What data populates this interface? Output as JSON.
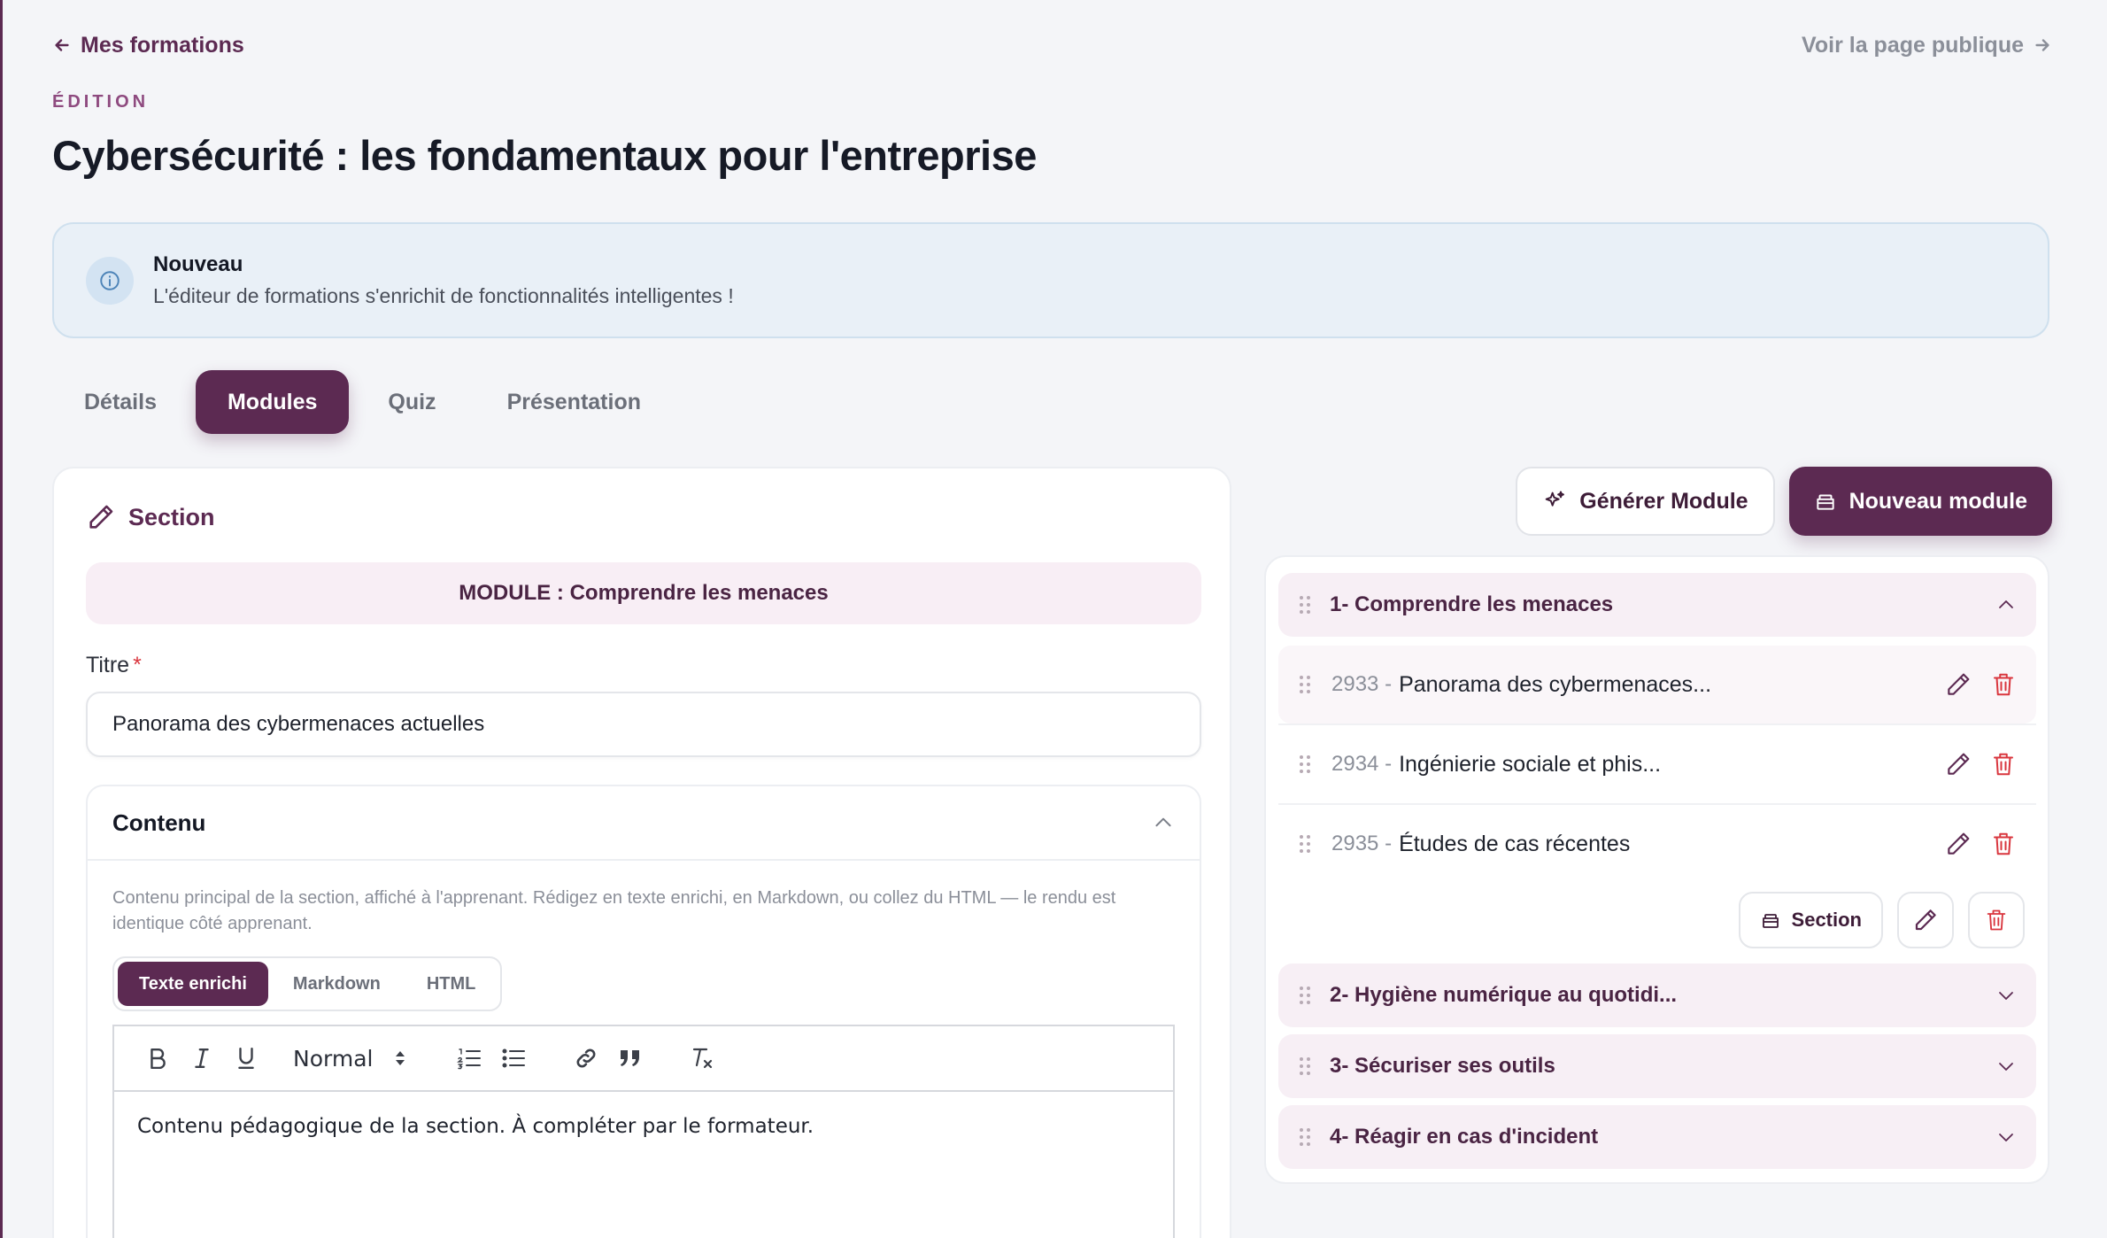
{
  "nav": {
    "back_label": "Mes formations",
    "public_label": "Voir la page publique"
  },
  "header": {
    "eyebrow": "ÉDITION",
    "title": "Cybersécurité : les fondamentaux pour l'entreprise"
  },
  "notice": {
    "title": "Nouveau",
    "text": "L'éditeur de formations s'enrichit de fonctionnalités intelligentes !"
  },
  "tabs": [
    {
      "label": "Détails",
      "active": false
    },
    {
      "label": "Modules",
      "active": true
    },
    {
      "label": "Quiz",
      "active": false
    },
    {
      "label": "Présentation",
      "active": false
    }
  ],
  "section_form": {
    "heading": "Section",
    "module_banner": "MODULE : Comprendre les menaces",
    "title_label": "Titre",
    "required_mark": "*",
    "title_value": "Panorama des cybermenaces actuelles",
    "content": {
      "heading": "Contenu",
      "help": "Contenu principal de la section, affiché à l'apprenant. Rédigez en texte enrichi, en Markdown, ou collez du HTML — le rendu est identique côté apprenant.",
      "modes": [
        "Texte enrichi",
        "Markdown",
        "HTML"
      ],
      "active_mode": "Texte enrichi",
      "format_select": "Normal",
      "body": "Contenu pédagogique de la section. À compléter par le formateur."
    }
  },
  "actions": {
    "generate_label": "Générer Module",
    "new_label": "Nouveau module"
  },
  "modules": [
    {
      "label": "1- Comprendre les menaces",
      "expanded": true,
      "sections": [
        {
          "id": "2933",
          "sep": "-",
          "title": "Panorama des cybermenaces..."
        },
        {
          "id": "2934",
          "sep": "-",
          "title": "Ingénierie sociale et phis..."
        },
        {
          "id": "2935",
          "sep": "-",
          "title": "Études de cas récentes"
        }
      ],
      "add_section_label": "Section"
    },
    {
      "label": "2- Hygiène numérique au quotidi...",
      "expanded": false
    },
    {
      "label": "3- Sécuriser ses outils",
      "expanded": false
    },
    {
      "label": "4- Réagir en cas d'incident",
      "expanded": false
    }
  ],
  "colors": {
    "brand": "#5c2a52",
    "danger": "#d9363e",
    "info_bg": "#e9f0f7"
  }
}
